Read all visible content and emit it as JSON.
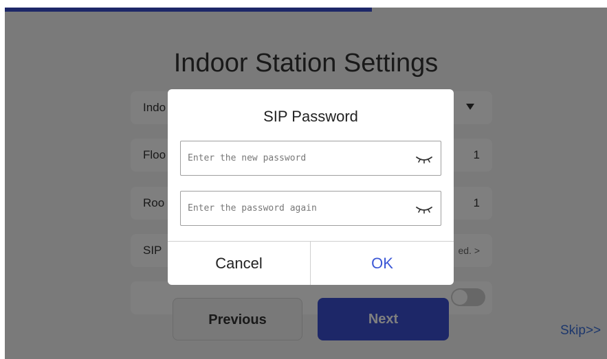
{
  "page": {
    "title": "Indoor Station Settings",
    "progress_fraction": 0.61
  },
  "settings_rows": [
    {
      "label": "Indo",
      "value": "",
      "control": "dropdown"
    },
    {
      "label": "Floo",
      "value": "1"
    },
    {
      "label": "Roo",
      "value": "1"
    },
    {
      "label": "SIP",
      "value": "ed. >"
    },
    {
      "label": "",
      "value": "",
      "control": "toggle"
    }
  ],
  "footer": {
    "previous_label": "Previous",
    "next_label": "Next",
    "skip_label": "Skip>>"
  },
  "dialog": {
    "title": "SIP Password",
    "new_password": {
      "value": "",
      "placeholder": "Enter the new password",
      "icon": "eye-closed-icon"
    },
    "confirm_password": {
      "value": "",
      "placeholder": "Enter the password again",
      "icon": "eye-closed-icon"
    },
    "cancel_label": "Cancel",
    "ok_label": "OK"
  },
  "colors": {
    "accent": "#3b4fd1",
    "ok_text": "#3b57d6",
    "skip_link": "#3a6fd8"
  }
}
